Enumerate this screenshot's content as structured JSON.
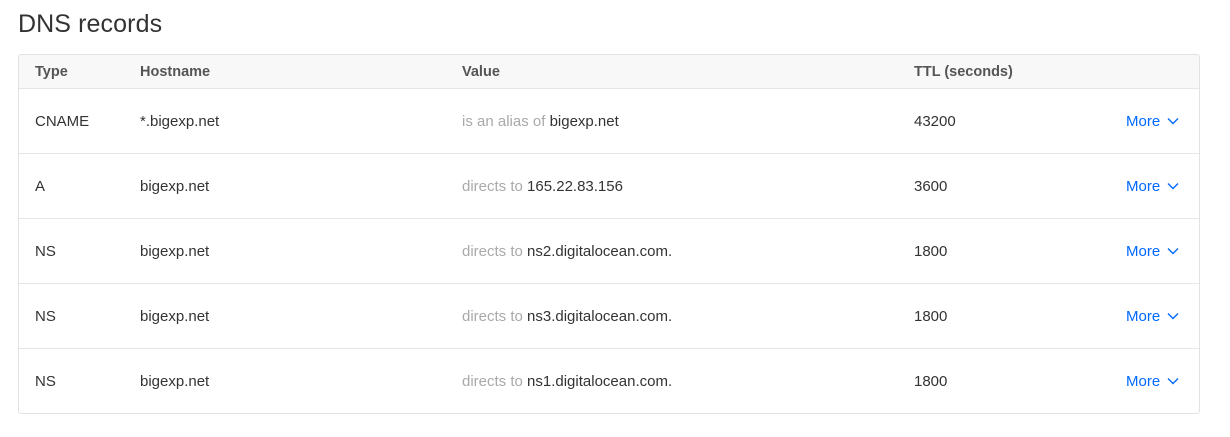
{
  "page": {
    "title": "DNS records"
  },
  "table": {
    "headers": {
      "type": "Type",
      "hostname": "Hostname",
      "value": "Value",
      "ttl": "TTL (seconds)"
    },
    "rows": [
      {
        "type": "CNAME",
        "hostname": "*.bigexp.net",
        "value_prefix": "is an alias of",
        "value": "bigexp.net",
        "ttl": "43200",
        "action": "More"
      },
      {
        "type": "A",
        "hostname": "bigexp.net",
        "value_prefix": "directs to",
        "value": "165.22.83.156",
        "ttl": "3600",
        "action": "More"
      },
      {
        "type": "NS",
        "hostname": "bigexp.net",
        "value_prefix": "directs to",
        "value": "ns2.digitalocean.com.",
        "ttl": "1800",
        "action": "More"
      },
      {
        "type": "NS",
        "hostname": "bigexp.net",
        "value_prefix": "directs to",
        "value": "ns3.digitalocean.com.",
        "ttl": "1800",
        "action": "More"
      },
      {
        "type": "NS",
        "hostname": "bigexp.net",
        "value_prefix": "directs to",
        "value": "ns1.digitalocean.com.",
        "ttl": "1800",
        "action": "More"
      }
    ]
  },
  "colors": {
    "link": "#0069ff",
    "muted": "#a9a9a9",
    "text": "#333333"
  },
  "icons": {
    "more": "chevron-down-icon"
  }
}
